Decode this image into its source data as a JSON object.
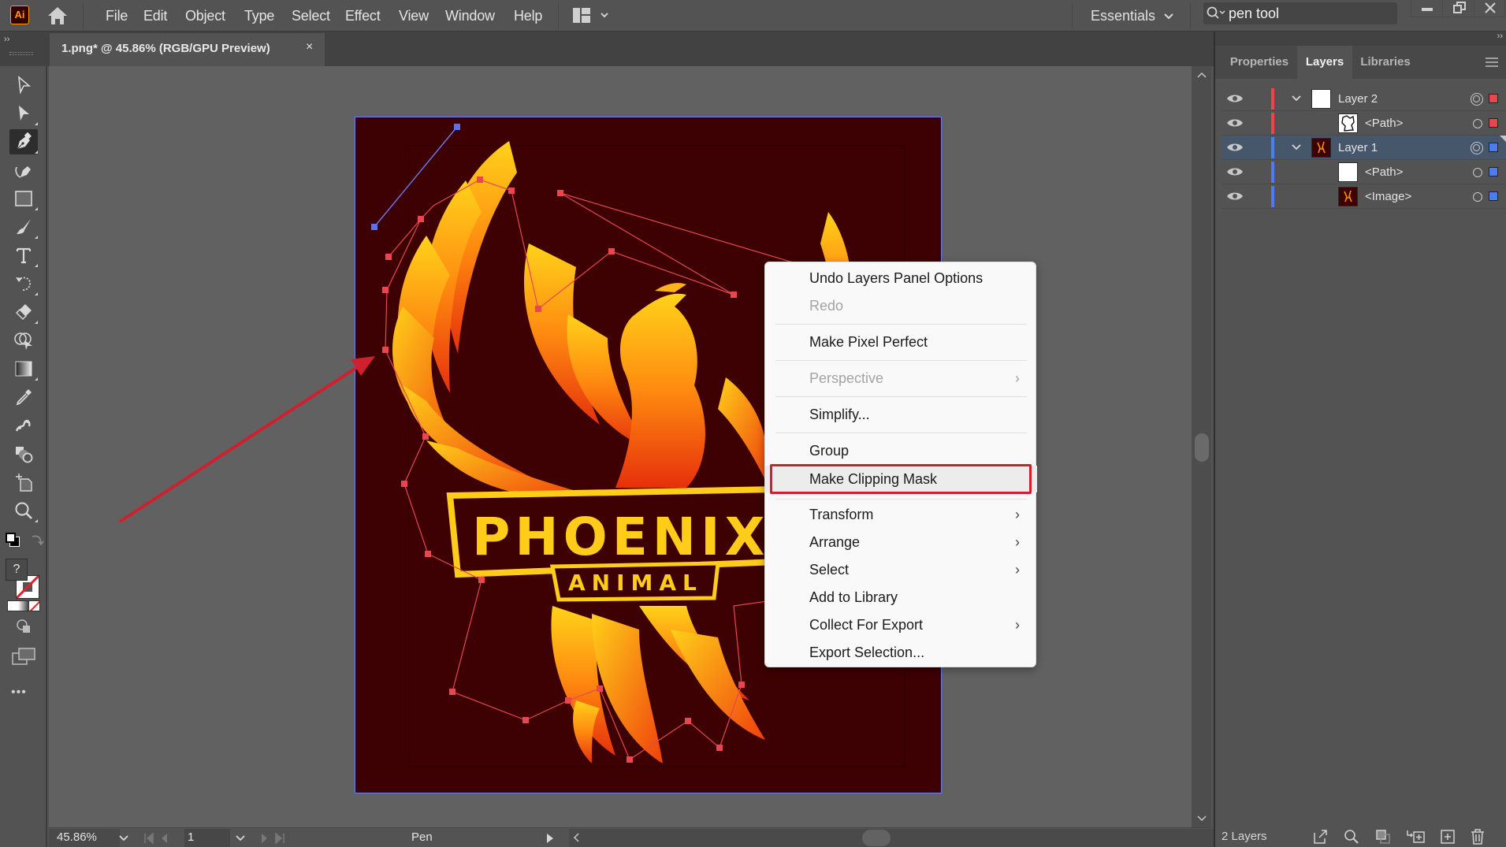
{
  "app": {
    "logo": "Ai",
    "menu": [
      "File",
      "Edit",
      "Object",
      "Type",
      "Select",
      "Effect",
      "View",
      "Window",
      "Help"
    ],
    "workspace": "Essentials",
    "search_value": "pen tool"
  },
  "document": {
    "tab_label": "1.png* @ 45.86% (RGB/GPU Preview)",
    "close_glyph": "×",
    "artwork_title": "PHOENIX",
    "artwork_subtitle": "ANIMAL"
  },
  "toolbar": {
    "tools": [
      "selection-tool",
      "direct-selection-tool",
      "pen-tool",
      "curvature-tool",
      "rectangle-tool",
      "paintbrush-tool",
      "type-tool",
      "rotate-tool",
      "eraser-tool",
      "shape-builder-tool",
      "gradient-tool",
      "eyedropper-tool",
      "puppet-warp-tool",
      "blend-tool",
      "artboard-tool",
      "zoom-tool"
    ],
    "active_tool": "pen-tool",
    "unknown_color_glyph": "?",
    "more_glyph": "•••"
  },
  "panel": {
    "tabs": [
      "Properties",
      "Layers",
      "Libraries"
    ],
    "active_tab": "Layers",
    "layers": [
      {
        "name": "Layer 2",
        "level": 0,
        "expanded": true,
        "color": "#e8474f",
        "selected": false,
        "thumb": "white"
      },
      {
        "name": "<Path>",
        "level": 1,
        "color": "#e8474f",
        "selected": false,
        "thumb": "path-outline"
      },
      {
        "name": "Layer 1",
        "level": 0,
        "expanded": true,
        "color": "#4d7cf0",
        "selected": true,
        "thumb": "image"
      },
      {
        "name": "<Path>",
        "level": 1,
        "color": "#4d7cf0",
        "selected": false,
        "thumb": "white"
      },
      {
        "name": "<Image>",
        "level": 1,
        "color": "#4d7cf0",
        "selected": false,
        "thumb": "image"
      }
    ],
    "footer_label": "2 Layers"
  },
  "status": {
    "zoom": "45.86%",
    "artboard_number": "1",
    "current_tool": "Pen"
  },
  "context_menu": {
    "items": [
      {
        "label": "Undo Layers Panel Options",
        "disabled": false,
        "submenu": false
      },
      {
        "label": "Redo",
        "disabled": true,
        "submenu": false
      },
      {
        "label": "Make Pixel Perfect",
        "disabled": false,
        "submenu": false
      },
      {
        "label": "Perspective",
        "disabled": true,
        "submenu": true
      },
      {
        "label": "Simplify...",
        "disabled": false,
        "submenu": false
      },
      {
        "label": "Group",
        "disabled": false,
        "submenu": false
      },
      {
        "label": "Make Clipping Mask",
        "disabled": false,
        "submenu": false,
        "highlighted": true
      },
      {
        "label": "Transform",
        "disabled": false,
        "submenu": true
      },
      {
        "label": "Arrange",
        "disabled": false,
        "submenu": true
      },
      {
        "label": "Select",
        "disabled": false,
        "submenu": true
      },
      {
        "label": "Add to Library",
        "disabled": false,
        "submenu": false
      },
      {
        "label": "Collect For Export",
        "disabled": false,
        "submenu": true
      },
      {
        "label": "Export Selection...",
        "disabled": false,
        "submenu": false
      }
    ],
    "submenu_glyph": "›"
  },
  "colors": {
    "annotation_red": "#d0202e",
    "layer2_color": "#e8474f",
    "layer1_color": "#4d7cf0",
    "artboard_bg": "#3d0003"
  }
}
